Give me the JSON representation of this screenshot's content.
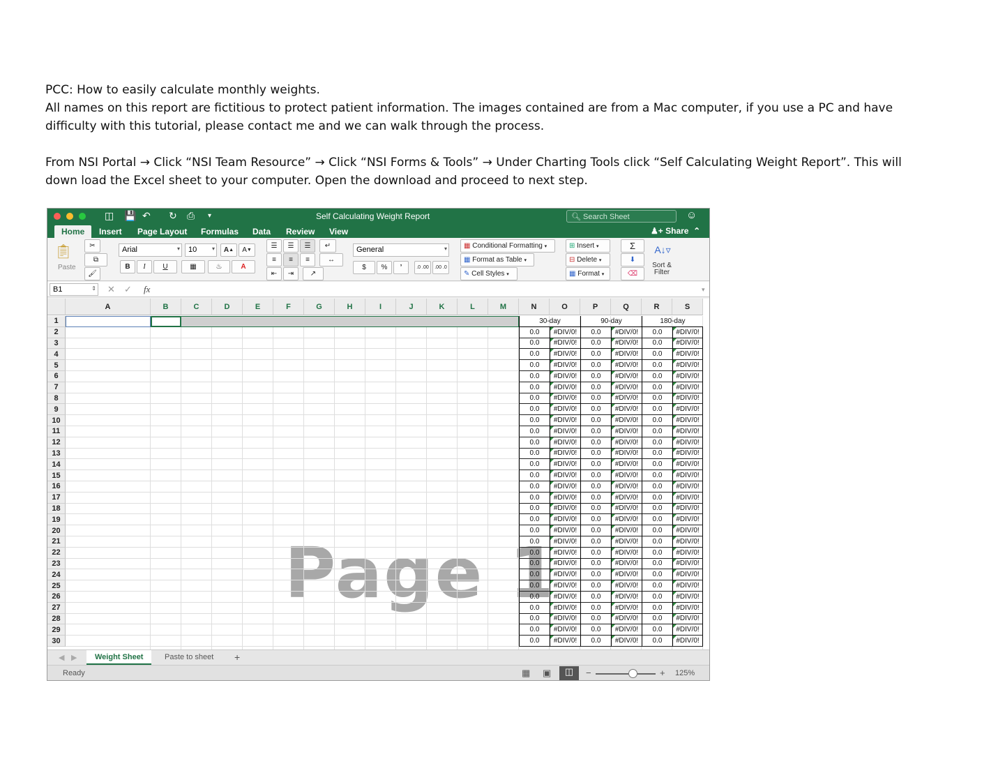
{
  "document": {
    "line1": "PCC: How to easily calculate monthly weights.",
    "line2": "All names on this report are fictitious to protect patient information. The images contained are from a Mac computer, if you use a PC and have",
    "line3": "difficulty with this tutorial, please contact me and we can walk through the process.",
    "line4": "From NSI Portal → Click “NSI Team Resource” →  Click “NSI Forms & Tools” → Under Charting Tools click “Self Calculating Weight Report”. This will",
    "line5": "down load the Excel sheet to your computer. Open the download and proceed to next step."
  },
  "excel": {
    "window_title": "Self Calculating Weight Report",
    "search_placeholder": "Search Sheet",
    "share_label": "Share",
    "tabs": [
      "Home",
      "Insert",
      "Page Layout",
      "Formulas",
      "Data",
      "Review",
      "View"
    ],
    "ribbon": {
      "paste_label": "Paste",
      "font_name": "Arial",
      "font_size": "10",
      "number_format": "General",
      "conditional_formatting": "Conditional Formatting",
      "format_as_table": "Format as Table",
      "cell_styles": "Cell Styles",
      "insert": "Insert",
      "delete": "Delete",
      "format": "Format",
      "sort_filter_line1": "Sort &",
      "sort_filter_line2": "Filter",
      "bold": "B",
      "italic": "I",
      "underline": "U",
      "font_grow": "A",
      "font_shrink": "A",
      "currency": "$",
      "percent": "%",
      "comma": "’",
      "inc_decimal": ".0 .00",
      "dec_decimal": ".00 .0",
      "sum": "Σ"
    },
    "name_box": "B1",
    "fx_label": "fx",
    "columns": [
      "A",
      "B",
      "C",
      "D",
      "E",
      "F",
      "G",
      "H",
      "I",
      "J",
      "K",
      "L",
      "M",
      "N",
      "O",
      "P",
      "Q",
      "R",
      "S"
    ],
    "period_headers": [
      "30-day",
      "90-day",
      "180-day"
    ],
    "row_count": 30,
    "num_value": "0.0",
    "err_value": "#DIV/0!",
    "watermark": "Page 1",
    "sheet_tabs": [
      "Weight Sheet",
      "Paste to sheet"
    ],
    "add_sheet": "+",
    "status": "Ready",
    "zoom": "125%",
    "zoom_level_percent": 125,
    "accent_color": "#217346"
  }
}
